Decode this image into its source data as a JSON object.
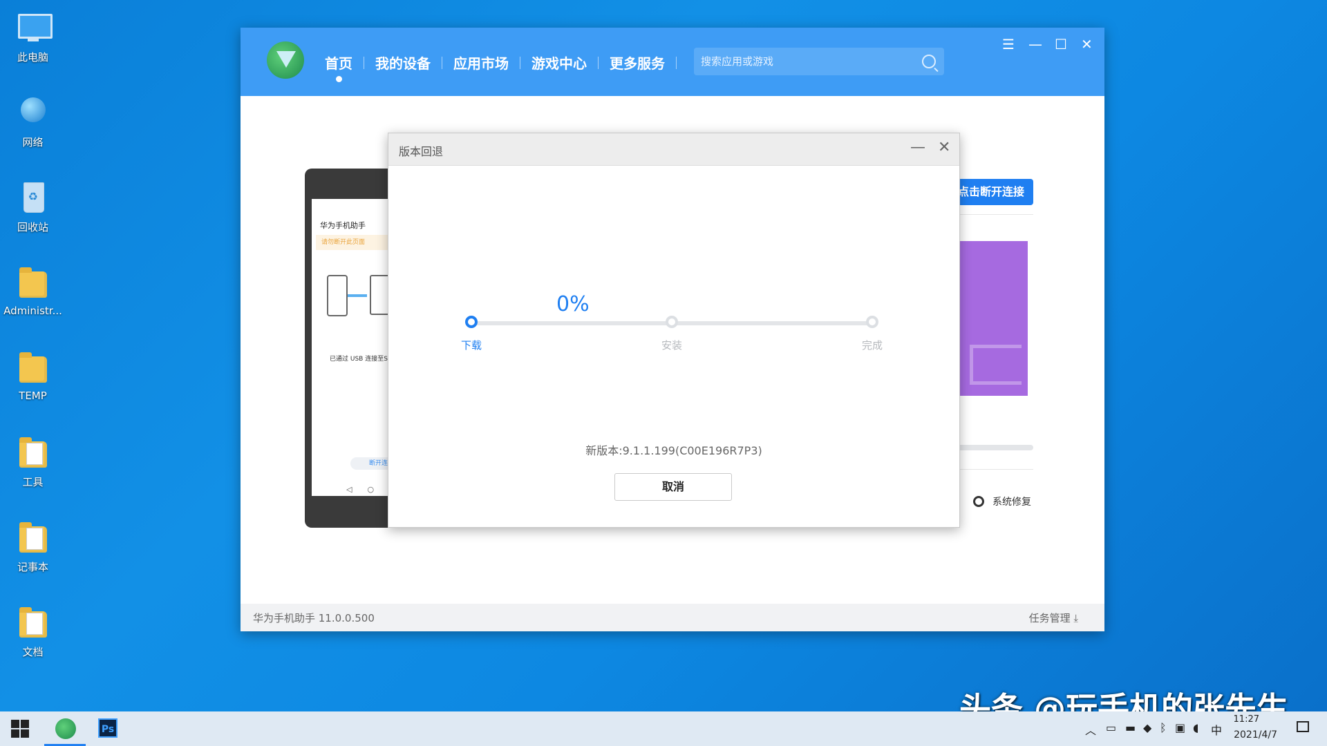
{
  "desktop": {
    "icons": [
      {
        "label": "此电脑",
        "icon": "computer-icon"
      },
      {
        "label": "网络",
        "icon": "network-icon"
      },
      {
        "label": "回收站",
        "icon": "recycle-bin-icon"
      },
      {
        "label": "Administr...",
        "icon": "user-folder-icon"
      },
      {
        "label": "TEMP",
        "icon": "folder-icon"
      },
      {
        "label": "工具",
        "icon": "folder-icon"
      },
      {
        "label": "记事本",
        "icon": "folder-icon"
      },
      {
        "label": "文档",
        "icon": "document-folder-icon"
      }
    ]
  },
  "app": {
    "nav": [
      "首页",
      "我的设备",
      "应用市场",
      "游戏中心",
      "更多服务"
    ],
    "active_nav": "首页",
    "search_placeholder": "搜索应用或游戏",
    "window_controls": {
      "menu": "☰",
      "minimize": "—",
      "maximize": "☐",
      "close": "✕"
    },
    "footer_version": "华为手机助手 11.0.0.500",
    "footer_task": "任务管理 ⤓",
    "disconnect_label": "点击断开连接",
    "system_repair": "系统修复",
    "phone_preview": {
      "title": "华为手机助手",
      "warning": "请勿断开此页面",
      "usb_text": "已通过 USB 连接至SC",
      "disconnect": "断开连接"
    }
  },
  "dialog": {
    "title": "版本回退",
    "percent": "0%",
    "progress": 0,
    "steps": [
      "下载",
      "安装",
      "完成"
    ],
    "active_step": 0,
    "new_version": "新版本:9.1.1.199(C00E196R7P3)",
    "cancel": "取消"
  },
  "taskbar": {
    "tray_lang": "中",
    "clock_time": "11:27",
    "clock_date": "2021/4/7",
    "ps_label": "Ps"
  },
  "watermark": "头条 @玩手机的张先生",
  "colors": {
    "accent": "#1f7ff1",
    "header": "#3e9cf5",
    "purple": "#a66ae0"
  }
}
